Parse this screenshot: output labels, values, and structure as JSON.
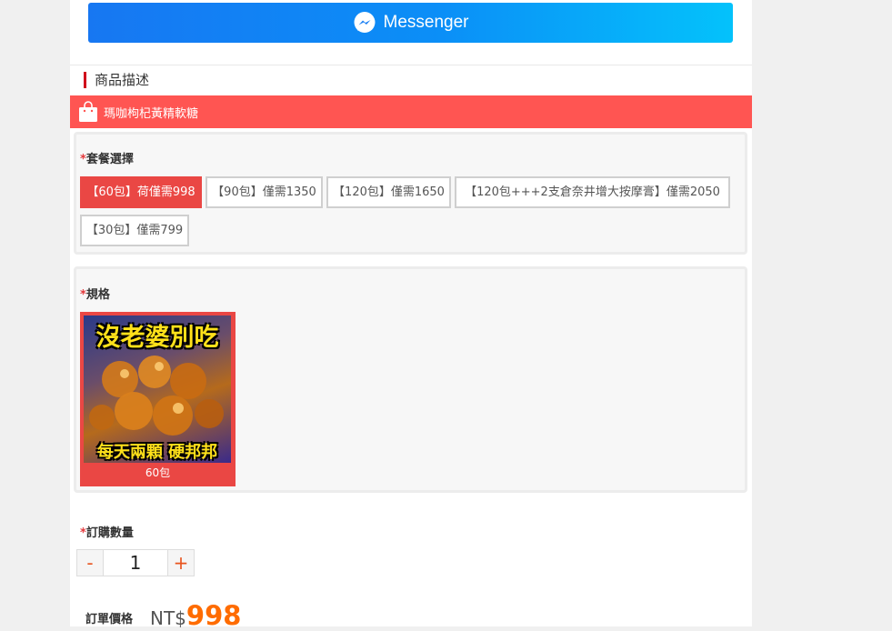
{
  "messenger": {
    "label": "Messenger",
    "colors": {
      "start": "#1777f2",
      "end": "#04c2fb"
    }
  },
  "description": {
    "title": "商品描述"
  },
  "banner": {
    "title": "瑪咖枸杞黃精軟糖",
    "color": "#ff5552"
  },
  "package": {
    "label": "套餐選擇",
    "options": [
      "【60包】荷僅需998",
      "【90包】僅需1350",
      "【120包】僅需1650",
      "【120包+++2支倉奈井增大按摩膏】僅需2050",
      "【30包】僅需799"
    ],
    "selected_index": 0
  },
  "spec": {
    "label": "規格",
    "item": {
      "image_text_top": "沒老婆別吃",
      "image_text_bottom": "每天兩顆 硬邦邦",
      "caption": "60包"
    }
  },
  "quantity": {
    "label": "訂購數量",
    "minus": "-",
    "value": "1",
    "plus": "+"
  },
  "price": {
    "label": "訂單價格",
    "currency": "NT$",
    "amount": "998"
  },
  "required_mark": "*"
}
